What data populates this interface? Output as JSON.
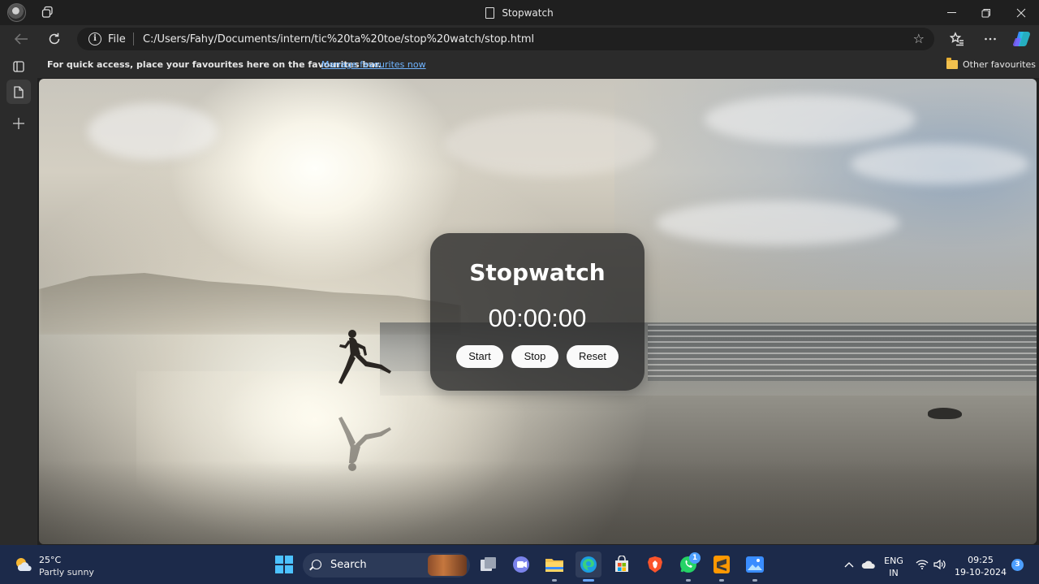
{
  "window": {
    "title": "Stopwatch"
  },
  "address": {
    "scheme_label": "File",
    "url": "C:/Users/Fahy/Documents/intern/tic%20ta%20toe/stop%20watch/stop.html"
  },
  "favourites": {
    "message": "For quick access, place your favourites here on the favourites bar.",
    "manage_link": "Manage favourites now",
    "other_label": "Other favourites"
  },
  "stopwatch": {
    "title": "Stopwatch",
    "time": "00:00:00",
    "start_label": "Start",
    "stop_label": "Stop",
    "reset_label": "Reset"
  },
  "taskbar": {
    "weather_temp": "25°C",
    "weather_desc": "Partly sunny",
    "search_label": "Search",
    "whatsapp_badge": "1",
    "language_top": "ENG",
    "language_bottom": "IN",
    "time": "09:25",
    "date": "19-10-2024",
    "notification_count": "3"
  },
  "colors": {
    "taskbar_bg": "#1c2a4a",
    "browser_chrome": "#2b2b2b",
    "link": "#6fb4ff",
    "card_bg": "rgba(40,40,40,0.78)"
  }
}
